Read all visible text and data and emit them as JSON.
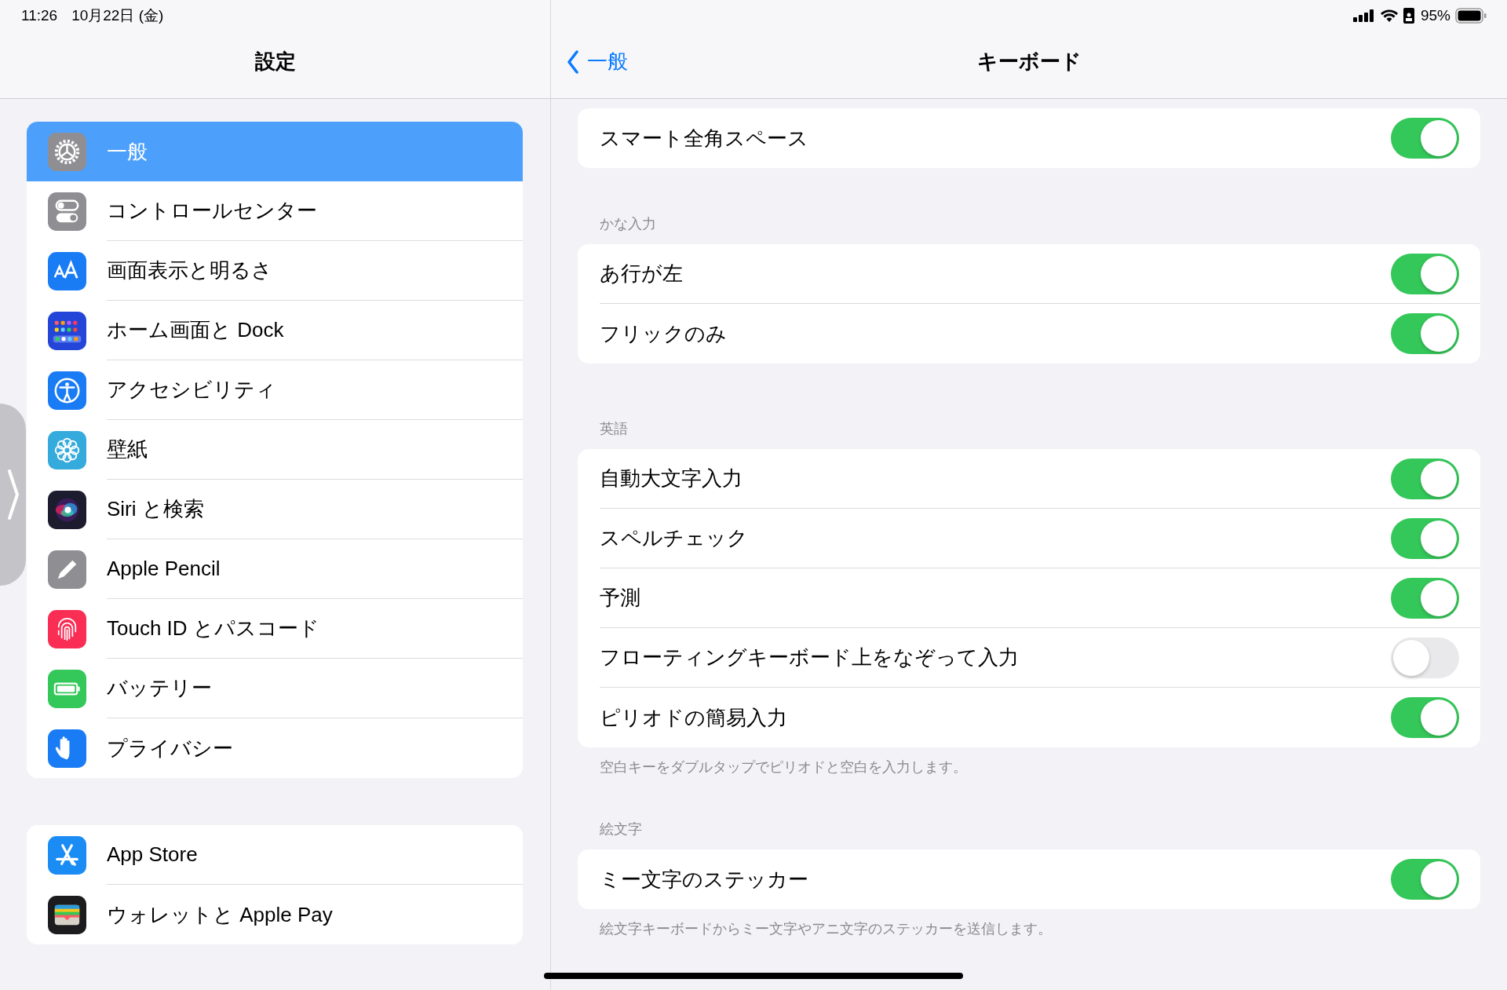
{
  "status_bar": {
    "time": "11:26",
    "date": "10月22日 (金)",
    "battery": "95%"
  },
  "sidebar": {
    "title": "設定",
    "groups": [
      {
        "items": [
          {
            "label": "一般",
            "selected": true
          },
          {
            "label": "コントロールセンター",
            "selected": false
          },
          {
            "label": "画面表示と明るさ",
            "selected": false
          },
          {
            "label": "ホーム画面と Dock",
            "selected": false
          },
          {
            "label": "アクセシビリティ",
            "selected": false
          },
          {
            "label": "壁紙",
            "selected": false
          },
          {
            "label": "Siri と検索",
            "selected": false
          },
          {
            "label": "Apple Pencil",
            "selected": false
          },
          {
            "label": "Touch ID とパスコード",
            "selected": false
          },
          {
            "label": "バッテリー",
            "selected": false
          },
          {
            "label": "プライバシー",
            "selected": false
          }
        ]
      },
      {
        "items": [
          {
            "label": "App Store",
            "selected": false
          },
          {
            "label": "ウォレットと Apple Pay",
            "selected": false
          }
        ]
      }
    ]
  },
  "detail": {
    "back": "一般",
    "title": "キーボード",
    "sections": [
      {
        "rows": [
          {
            "label": "スマート全角スペース",
            "on": true
          }
        ]
      },
      {
        "header": "かな入力",
        "rows": [
          {
            "label": "あ行が左",
            "on": true
          },
          {
            "label": "フリックのみ",
            "on": true
          }
        ]
      },
      {
        "header": "英語",
        "rows": [
          {
            "label": "自動大文字入力",
            "on": true
          },
          {
            "label": "スペルチェック",
            "on": true
          },
          {
            "label": "予測",
            "on": true
          },
          {
            "label": "フローティングキーボード上をなぞって入力",
            "on": false
          },
          {
            "label": "ピリオドの簡易入力",
            "on": true
          }
        ],
        "footer": "空白キーをダブルタップでピリオドと空白を入力します。"
      },
      {
        "header": "絵文字",
        "rows": [
          {
            "label": "ミー文字のステッカー",
            "on": true
          }
        ],
        "footer": "絵文字キーボードからミー文字やアニ文字のステッカーを送信します。"
      }
    ]
  }
}
